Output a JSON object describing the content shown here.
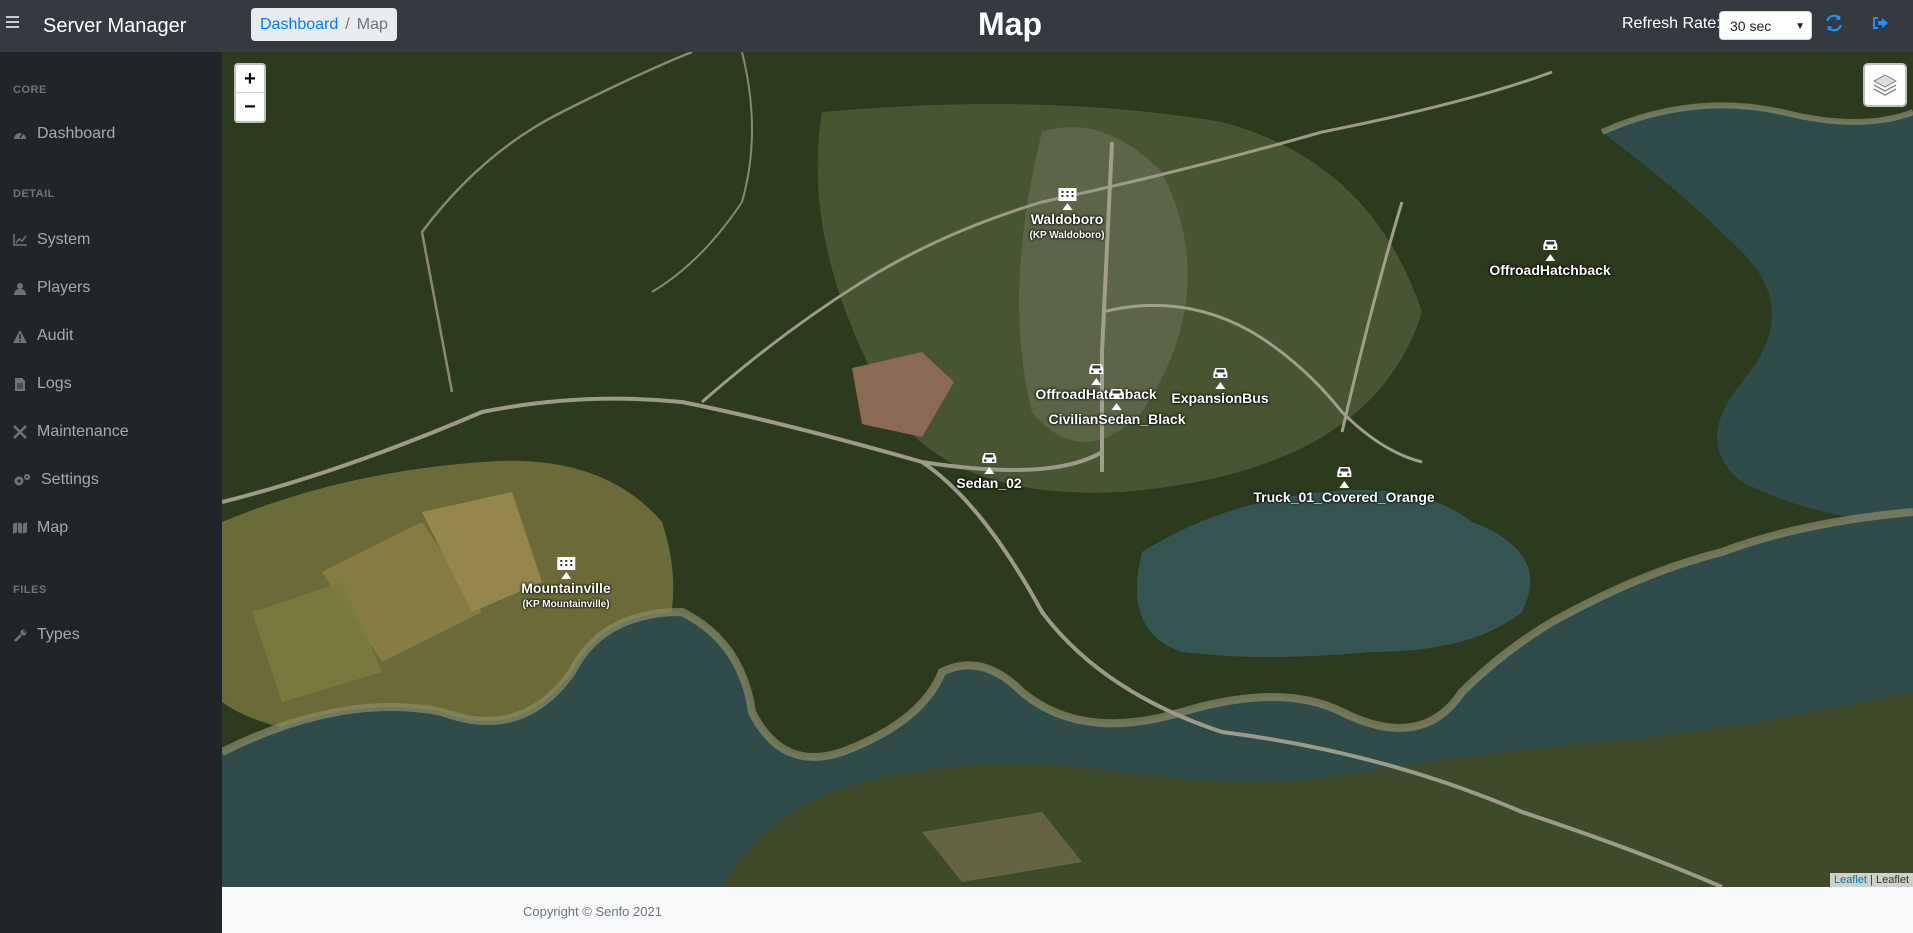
{
  "app": {
    "title": "Server Manager"
  },
  "breadcrumb": {
    "home": "Dashboard",
    "separator": "/",
    "current": "Map"
  },
  "page": {
    "title": "Map"
  },
  "refresh": {
    "label": "Refresh Rate:",
    "selected": "30 sec"
  },
  "colors": {
    "navbar": "#343a40",
    "sidebar": "#212529",
    "accent": "#007bff",
    "water": "#2e4f4f",
    "forest": "#2c3a1e"
  },
  "sidebar": {
    "sections": [
      {
        "heading": "CORE",
        "items": [
          {
            "label": "Dashboard",
            "icon": "gauge-icon"
          }
        ]
      },
      {
        "heading": "DETAIL",
        "items": [
          {
            "label": "System",
            "icon": "chart-icon"
          },
          {
            "label": "Players",
            "icon": "user-icon"
          },
          {
            "label": "Audit",
            "icon": "warning-icon"
          },
          {
            "label": "Logs",
            "icon": "file-icon"
          },
          {
            "label": "Maintenance",
            "icon": "tools-icon"
          },
          {
            "label": "Settings",
            "icon": "gears-icon"
          },
          {
            "label": "Map",
            "icon": "map-icon"
          }
        ]
      },
      {
        "heading": "FILES",
        "items": [
          {
            "label": "Types",
            "icon": "wrench-icon"
          }
        ]
      }
    ]
  },
  "map": {
    "zoom_in": "+",
    "zoom_out": "−",
    "attribution": {
      "link": "Leaflet",
      "separator": " | ",
      "text": "Leaflet"
    },
    "markers": [
      {
        "label": "Waldoboro",
        "sub": "(KP Waldoboro)",
        "icon": "building-icon"
      },
      {
        "label": "OffroadHatchback",
        "sub": "",
        "icon": "car-icon"
      },
      {
        "label": "OffroadHatchback",
        "sub": "",
        "icon": "car-icon"
      },
      {
        "label": "CivilianSedan_Black",
        "sub": "",
        "icon": "car-icon"
      },
      {
        "label": "ExpansionBus",
        "sub": "",
        "icon": "car-icon"
      },
      {
        "label": "Sedan_02",
        "sub": "",
        "icon": "car-icon"
      },
      {
        "label": "Truck_01_Covered_Orange",
        "sub": "",
        "icon": "car-icon"
      },
      {
        "label": "Mountainville",
        "sub": "(KP Mountainville)",
        "icon": "building-icon"
      }
    ]
  },
  "footer": {
    "copyright": "Copyright © Senfo 2021"
  }
}
